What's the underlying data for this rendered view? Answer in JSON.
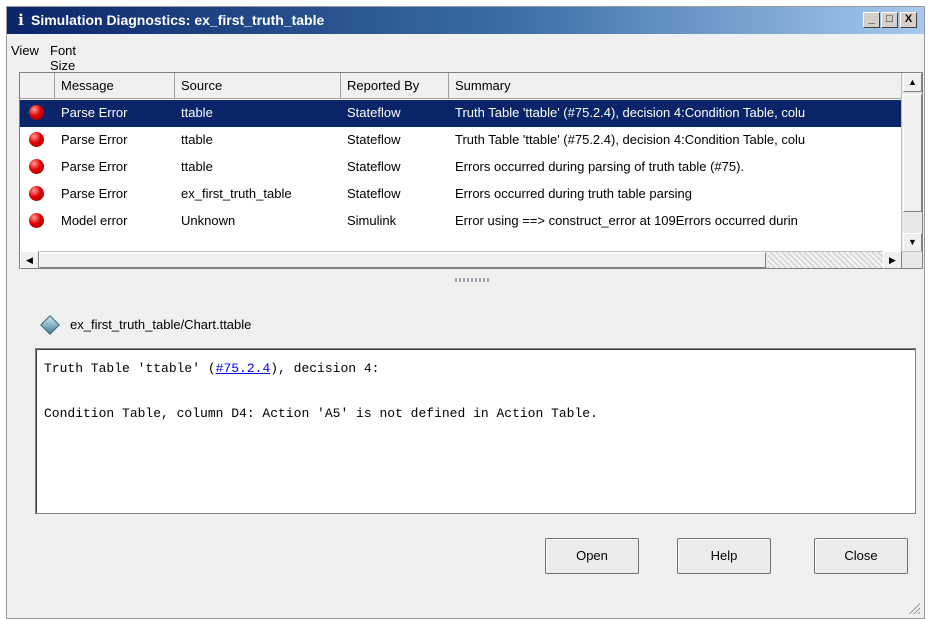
{
  "window": {
    "title": "Simulation Diagnostics: ex_first_truth_table",
    "title_icon": "info-icon",
    "controls": {
      "minimize": "_",
      "maximize": "□",
      "close": "X"
    }
  },
  "menu": {
    "items": [
      "View",
      "Font Size"
    ]
  },
  "table": {
    "columns": [
      "Message",
      "Source",
      "Reported By",
      "Summary"
    ],
    "rows": [
      {
        "message": "Parse Error",
        "source": "ttable",
        "reported_by": "Stateflow",
        "summary": "Truth Table 'ttable' (#75.2.4), decision 4:Condition Table, colu",
        "selected": true
      },
      {
        "message": "Parse Error",
        "source": "ttable",
        "reported_by": "Stateflow",
        "summary": "Truth Table 'ttable' (#75.2.4), decision 4:Condition Table, colu",
        "selected": false
      },
      {
        "message": "Parse Error",
        "source": "ttable",
        "reported_by": "Stateflow",
        "summary": "Errors occurred during parsing of truth table (#75).",
        "selected": false
      },
      {
        "message": "Parse Error",
        "source": "ex_first_truth_table",
        "reported_by": "Stateflow",
        "summary": "Errors occurred during truth table parsing",
        "selected": false
      },
      {
        "message": "Model error",
        "source": "Unknown",
        "reported_by": "Simulink",
        "summary": "Error using ==> construct_error at 109Errors occurred durin",
        "selected": false
      }
    ],
    "status_icon": "error-dot-icon",
    "error_color": "#e00000",
    "selection_color": "#0a246a"
  },
  "detail": {
    "path": "ex_first_truth_table/Chart.ttable",
    "path_icon": "stateflow-chart-icon",
    "line1_prefix": "Truth Table 'ttable' (",
    "line1_link": "#75.2.4",
    "line1_suffix": "), decision 4:",
    "line2": "Condition Table, column D4: Action 'A5' is not defined in Action Table."
  },
  "buttons": {
    "open": "Open",
    "help": "Help",
    "close": "Close"
  }
}
